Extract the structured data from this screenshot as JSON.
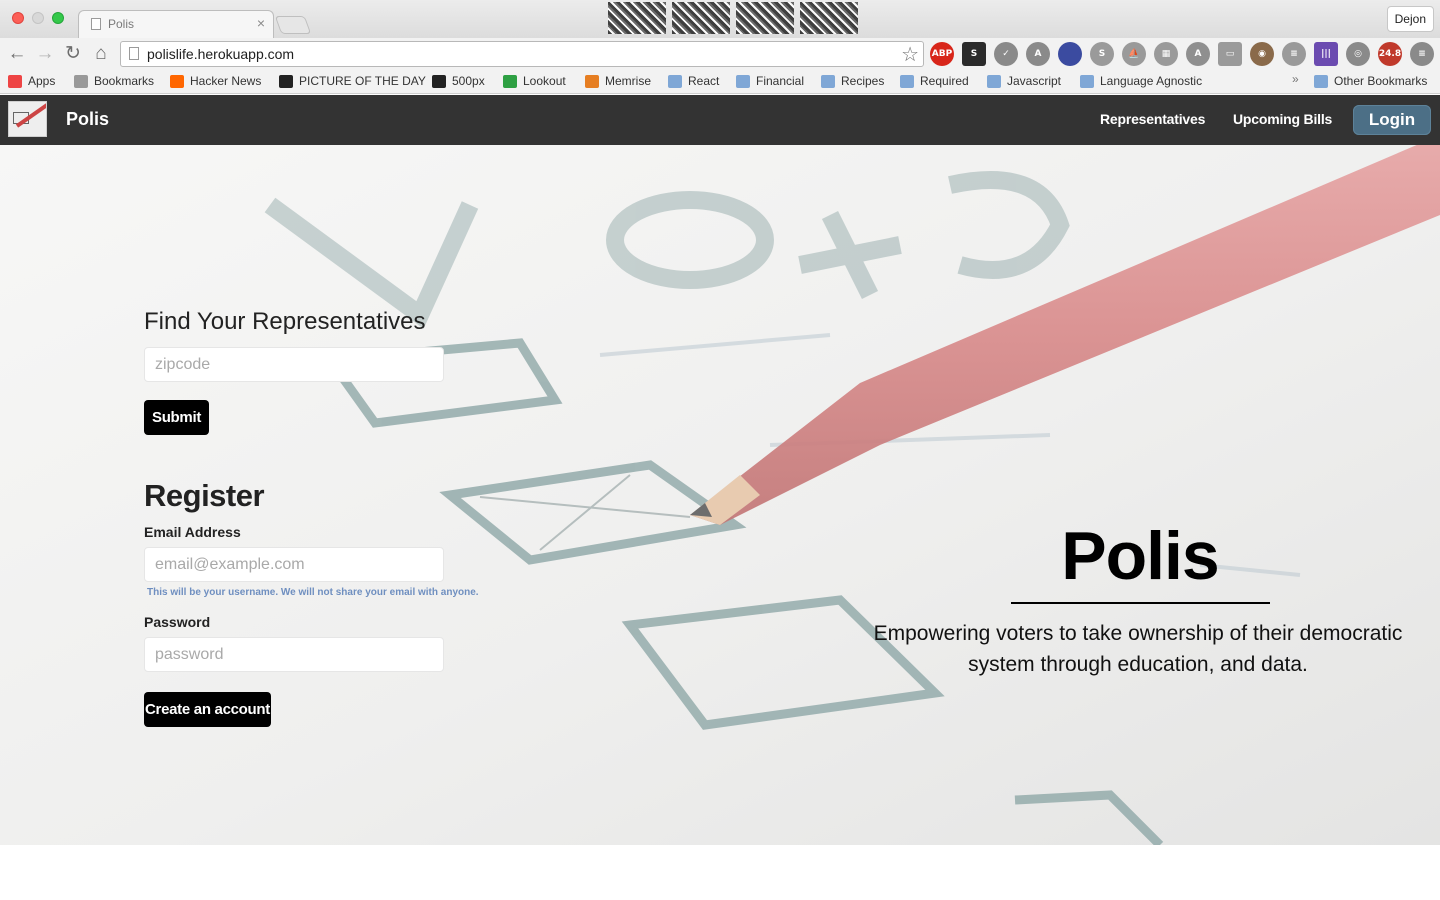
{
  "browser": {
    "tab_title": "Polis",
    "tab_close": "×",
    "profile_name": "Dejon",
    "url": "polislife.herokuapp.com",
    "star_glyph": "☆",
    "nav_glyphs": {
      "back": "←",
      "forward": "→",
      "reload": "↻",
      "home": "⌂"
    },
    "extensions": [
      {
        "icon": "adblock-plus-icon",
        "label": "ABP",
        "color": "#d8261a"
      },
      {
        "icon": "s-extension-icon",
        "label": "S",
        "color": "#2b2b2b"
      },
      {
        "icon": "compass-icon",
        "label": "✓",
        "color": "#8a8a8a"
      },
      {
        "icon": "a-circle-icon",
        "label": "A",
        "color": "#8a8a8a"
      },
      {
        "icon": "flag-icon",
        "label": "",
        "color": "#3b4ba0"
      },
      {
        "icon": "skype-icon",
        "label": "S",
        "color": "#9a9a9a"
      },
      {
        "icon": "ship-icon",
        "label": "⛵",
        "color": "#9a9a9a"
      },
      {
        "icon": "grid-icon",
        "label": "▦",
        "color": "#9a9a9a"
      },
      {
        "icon": "angular-icon",
        "label": "A",
        "color": "#8f8f8f"
      },
      {
        "icon": "window-icon",
        "label": "▭",
        "color": "#9a9a9a"
      },
      {
        "icon": "instagram-icon",
        "label": "◉",
        "color": "#8a6a4a"
      },
      {
        "icon": "lamp-icon",
        "label": "≡",
        "color": "#9a9a9a"
      },
      {
        "icon": "bars-icon",
        "label": "|||",
        "color": "#6b4bb0"
      },
      {
        "icon": "target-icon",
        "label": "◎",
        "color": "#8a8a8a"
      },
      {
        "icon": "speedometer-icon",
        "label": "24.8",
        "color": "#c0392b"
      },
      {
        "icon": "menu-icon",
        "label": "≡",
        "color": "#8a8a8a"
      }
    ],
    "bookmarks": [
      {
        "label": "Apps",
        "icon": "apps-grid-icon",
        "color": "#e44"
      },
      {
        "label": "Bookmarks",
        "icon": "star-icon",
        "color": "#999"
      },
      {
        "label": "Hacker News",
        "icon": "y-icon",
        "color": "#ff6600"
      },
      {
        "label": "PICTURE OF THE DAY",
        "icon": "picture-icon",
        "color": "#222"
      },
      {
        "label": "500px",
        "icon": "five-hundred-icon",
        "color": "#222"
      },
      {
        "label": "Lookout",
        "icon": "shield-icon",
        "color": "#2ea043"
      },
      {
        "label": "Memrise",
        "icon": "memrise-icon",
        "color": "#e67e22"
      },
      {
        "label": "React",
        "icon": "folder-icon",
        "color": "#7fa7d6"
      },
      {
        "label": "Financial",
        "icon": "folder-icon",
        "color": "#7fa7d6"
      },
      {
        "label": "Recipes",
        "icon": "folder-icon",
        "color": "#7fa7d6"
      },
      {
        "label": "Required",
        "icon": "folder-icon",
        "color": "#7fa7d6"
      },
      {
        "label": "Javascript",
        "icon": "folder-icon",
        "color": "#7fa7d6"
      },
      {
        "label": "Language Agnostic",
        "icon": "folder-icon",
        "color": "#7fa7d6"
      }
    ],
    "more_bookmarks": "»",
    "other_bookmarks": "Other Bookmarks"
  },
  "app": {
    "brand": "Polis",
    "nav": {
      "representatives": "Representatives",
      "upcoming_bills": "Upcoming Bills",
      "login": "Login"
    },
    "find": {
      "title": "Find Your Representatives",
      "zip_placeholder": "zipcode",
      "submit": "Submit"
    },
    "register": {
      "title": "Register",
      "email_label": "Email Address",
      "email_placeholder": "email@example.com",
      "email_help": "This will be your username. We will not share your email with anyone.",
      "password_label": "Password",
      "password_placeholder": "password",
      "create_button": "Create an account"
    },
    "hero": {
      "title": "Polis",
      "tagline": "Empowering voters to take ownership of their democratic system through education, and data."
    }
  }
}
